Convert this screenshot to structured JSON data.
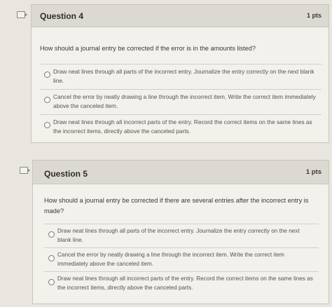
{
  "questions": [
    {
      "title": "Question 4",
      "points": "1 pts",
      "prompt": "How should a journal entry be corrected if the error is in the amounts listed?",
      "answers": [
        {
          "label": "Draw neat lines through all parts of the incorrect entry. Journalize the entry correctly on the next blank line."
        },
        {
          "label": "Cancel the error by neatly drawing a line through the incorrect item. Write the correct item immediately above the canceled item."
        },
        {
          "label": "Draw neat lines through all incorrect parts of the entry. Record the correct items on the same lines as the incorrect items, directly above the canceled parts."
        }
      ]
    },
    {
      "title": "Question 5",
      "points": "1 pts",
      "prompt": "How should a journal entry be corrected if there are several entries after the incorrect entry is made?",
      "answers": [
        {
          "label": "Draw neat lines through all parts of the incorrect entry. Journalize the entry correctly on the next blank line."
        },
        {
          "label": "Cancel the error by neatly drawing a line through the incorrect item. Write the correct item immediately above the canceled item."
        },
        {
          "label": "Draw neat lines through all incorrect parts of the entry. Record the correct items on the same lines as the incorrect items, directly above the canceled parts."
        }
      ]
    }
  ]
}
